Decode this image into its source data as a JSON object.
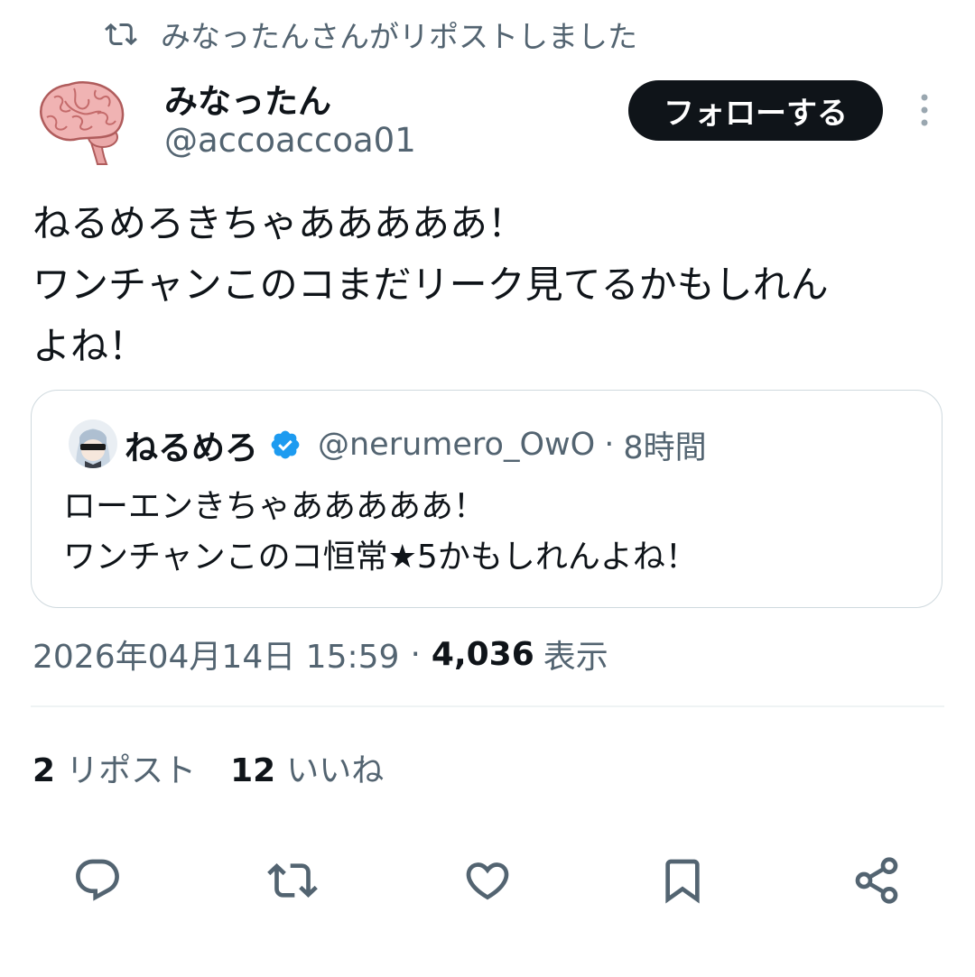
{
  "repost_context": {
    "text": "みなったんさんがリポストしました",
    "icon": "repost-icon"
  },
  "author": {
    "name": "みなったん",
    "handle": "@accoaccoa01",
    "avatar": "brain-avatar"
  },
  "follow_button": {
    "label": "フォローする"
  },
  "more_menu": {
    "icon": "more-vertical-icon"
  },
  "tweet": {
    "lines": [
      "ねるめろきちゃあああああ！",
      "ワンチャンこのコまだリーク見てるかもしれん",
      "よね！"
    ]
  },
  "quote": {
    "name": "ねるめろ",
    "verified_icon": "verified-badge-icon",
    "handle": "@nerumero_OwO",
    "separator": "·",
    "time": "8時間",
    "lines": [
      "ローエンきちゃあああああ！",
      "ワンチャンこのコ恒常★5かもしれんよね！"
    ]
  },
  "meta": {
    "timestamp": "2026年04月14日 15:59",
    "separator": "·",
    "views_count": "4,036",
    "views_label": "表示"
  },
  "stats": {
    "reposts_count": "2",
    "reposts_label": "リポスト",
    "likes_count": "12",
    "likes_label": "いいね"
  },
  "actions": [
    {
      "name": "reply",
      "icon": "reply-icon"
    },
    {
      "name": "repost",
      "icon": "repost-icon"
    },
    {
      "name": "like",
      "icon": "heart-icon"
    },
    {
      "name": "bookmark",
      "icon": "bookmark-icon"
    },
    {
      "name": "share",
      "icon": "share-icon"
    }
  ],
  "colors": {
    "text_primary": "#0f1419",
    "text_secondary": "#536471",
    "border": "#cfd9de",
    "verified_blue": "#1d9bf0",
    "follow_bg": "#0f1419"
  }
}
